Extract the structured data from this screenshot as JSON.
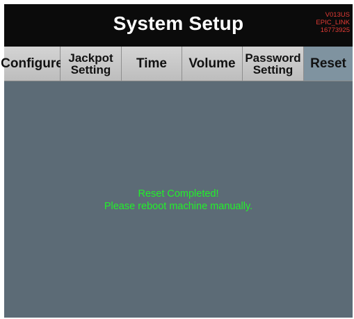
{
  "header": {
    "title": "System Setup",
    "version_lines": [
      "V013US",
      "EPIC_LINK",
      "16773925"
    ]
  },
  "tabs": [
    {
      "label": "Configure"
    },
    {
      "label_line1": "Jackpot",
      "label_line2": "Setting"
    },
    {
      "label": "Time"
    },
    {
      "label": "Volume"
    },
    {
      "label_line1": "Password",
      "label_line2": "Setting"
    },
    {
      "label": "Reset",
      "active": true
    }
  ],
  "main": {
    "message_line1": "Reset Completed!",
    "message_line2": "Please reboot machine manually."
  },
  "colors": {
    "header_bg": "#0b0b0b",
    "screen_bg": "#5c6b76",
    "active_tab_bg": "#7f93a0",
    "version_text": "#e23b35",
    "message_text": "#22f02a"
  }
}
